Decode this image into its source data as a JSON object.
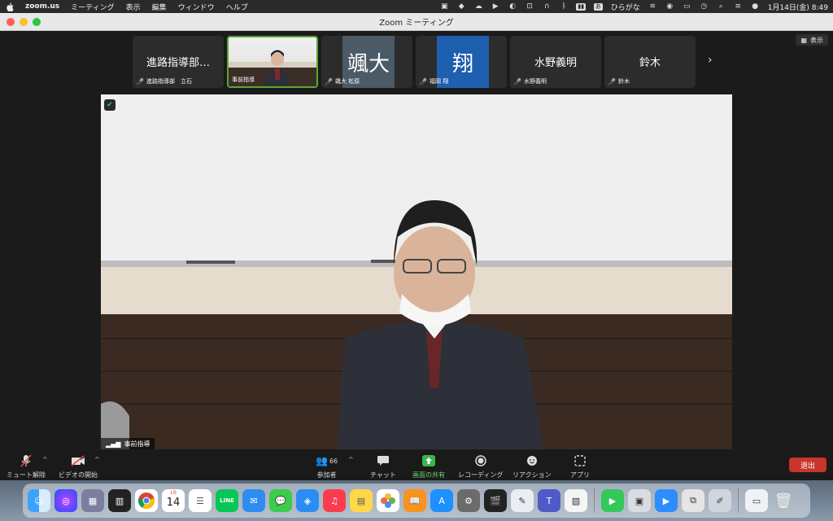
{
  "menubar": {
    "app": "zoom.us",
    "menus": [
      "ミーティング",
      "表示",
      "編集",
      "ウィンドウ",
      "ヘルプ"
    ],
    "ime": "ひらがな",
    "datetime": "1月14日(金)  8:49"
  },
  "window": {
    "title": "Zoom ミーティング",
    "view_label": "表示"
  },
  "participants_strip": [
    {
      "display": "進路指導部…",
      "caption": "進路指導部　立石",
      "muted": true,
      "type": "name"
    },
    {
      "display": "",
      "caption": "事前指導",
      "muted": false,
      "type": "video",
      "active": true
    },
    {
      "display": "颯大",
      "caption": "颯大 松原",
      "muted": true,
      "type": "avatar",
      "color": "#4a5a66"
    },
    {
      "display": "翔",
      "caption": "福岡 翔",
      "muted": true,
      "type": "avatar",
      "color": "#1f5fb0"
    },
    {
      "display": "水野義明",
      "caption": "水野義明",
      "muted": true,
      "type": "name"
    },
    {
      "display": "鈴木",
      "caption": "鈴木",
      "muted": true,
      "type": "name"
    }
  ],
  "main_video": {
    "speaker_label": "事前指導"
  },
  "toolbar": {
    "mute_label": "ミュート解除",
    "video_label": "ビデオの開始",
    "participants_label": "参加者",
    "participants_count": "66",
    "chat_label": "チャット",
    "share_label": "画面の共有",
    "record_label": "レコーディング",
    "reaction_label": "リアクション",
    "apps_label": "アプリ",
    "leave_label": "退出"
  },
  "dock": {
    "calendar_month": "1月",
    "calendar_day": "14",
    "line_label": "LINE"
  },
  "colors": {
    "active_border": "#5aa832",
    "share_green": "#3cb54a",
    "leave_red": "#c7352b"
  }
}
